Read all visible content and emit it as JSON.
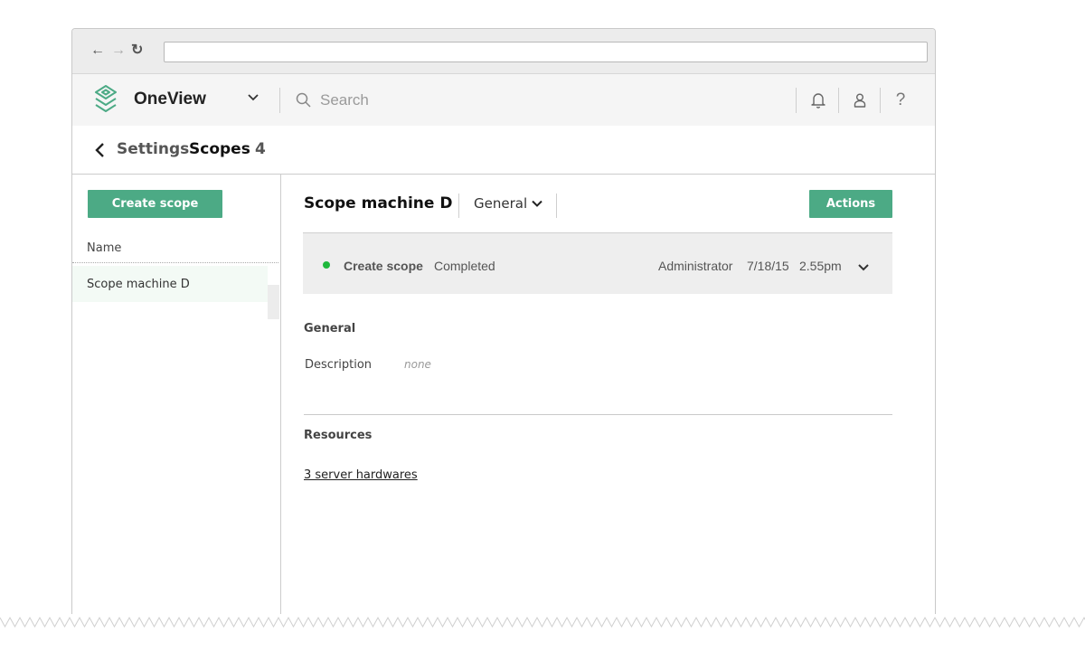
{
  "browser": {
    "url": ""
  },
  "header": {
    "app_name": "OneView",
    "search_placeholder": "Search",
    "help_label": "?"
  },
  "breadcrumb": {
    "parent": "Settings",
    "current": "Scopes",
    "count": "4"
  },
  "sidebar": {
    "create_button": "Create scope",
    "column_header": "Name",
    "items": [
      {
        "label": "Scope machine D"
      }
    ]
  },
  "main": {
    "title": "Scope machine D",
    "view_selector": "General",
    "actions_button": "Actions",
    "activity": {
      "name": "Create scope",
      "status": "Completed",
      "status_color": "#1fb83c",
      "user": "Administrator",
      "date": "7/18/15",
      "time": "2.55pm"
    },
    "general": {
      "title": "General",
      "description_label": "Description",
      "description_value": "none"
    },
    "resources": {
      "title": "Resources",
      "link": "3 server hardwares"
    }
  },
  "colors": {
    "accent": "#4caa85"
  },
  "icons": [
    "back-arrow-icon",
    "forward-arrow-icon",
    "reload-icon",
    "oneview-logo-icon",
    "chevron-down-icon",
    "search-icon",
    "bell-icon",
    "user-icon",
    "help-icon"
  ]
}
